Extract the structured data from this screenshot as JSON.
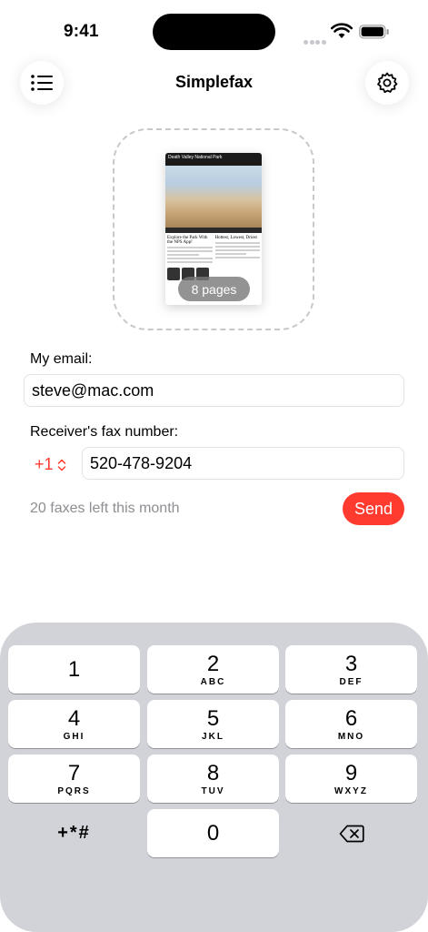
{
  "status_bar": {
    "time": "9:41"
  },
  "header": {
    "title": "Simplefax",
    "menu_icon": "list-icon",
    "settings_icon": "gear-icon"
  },
  "document": {
    "pages_label": "8 pages",
    "thumbnail": {
      "title": "Death Valley National Park",
      "headline_left": "Explore the Park With the NPS App!",
      "headline_right": "Hottest, Lowest, Driest"
    }
  },
  "form": {
    "email_label": "My email:",
    "email_value": "steve@mac.com",
    "fax_label": "Receiver's fax number:",
    "country_code": "+1",
    "fax_value": "520-478-9204",
    "quota_text": "20 faxes left this month",
    "send_label": "Send"
  },
  "keypad": {
    "keys": [
      {
        "num": "1",
        "letters": ""
      },
      {
        "num": "2",
        "letters": "ABC"
      },
      {
        "num": "3",
        "letters": "DEF"
      },
      {
        "num": "4",
        "letters": "GHI"
      },
      {
        "num": "5",
        "letters": "JKL"
      },
      {
        "num": "6",
        "letters": "MNO"
      },
      {
        "num": "7",
        "letters": "PQRS"
      },
      {
        "num": "8",
        "letters": "TUV"
      },
      {
        "num": "9",
        "letters": "WXYZ"
      },
      {
        "num": "+*#",
        "letters": ""
      },
      {
        "num": "0",
        "letters": ""
      }
    ],
    "delete_icon": "backspace-icon"
  },
  "colors": {
    "accent": "#ff3b30",
    "keypad_bg": "#d1d3d9",
    "secondary_text": "#8e8e93"
  }
}
